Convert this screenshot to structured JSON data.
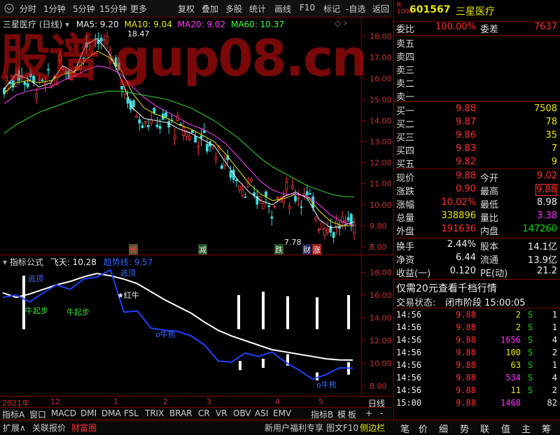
{
  "toolbar": {
    "items": [
      "分时",
      "1分钟",
      "5分钟",
      "15分钟",
      "更多",
      "复权",
      "叠加",
      "多股",
      "统计",
      "画线",
      "F10",
      "标记",
      "-自选",
      "返回"
    ]
  },
  "watermark": "股谱 gup08.cn",
  "main_chart": {
    "title": "三星医疗 (日线)",
    "ma5": "MA5: 9.20",
    "ma10": "MA10: 9.04",
    "ma20": "MA20: 9.02",
    "ma60": "MA60: 10.37",
    "high_label": "18.47",
    "low_label": "7.78",
    "yticks": [
      "18.00",
      "17.00",
      "16.00",
      "15.00",
      "14.00",
      "13.00",
      "12.00",
      "11.00",
      "10.00",
      "9.00",
      "8.00"
    ],
    "markers": [
      "榜",
      "减",
      "跌",
      "财",
      "涨"
    ]
  },
  "indicator": {
    "title": "指标公式",
    "feitian": "飞天: 10.28",
    "qushi": "趋势线: 9.57",
    "yticks": [
      "18.00",
      "16.00",
      "14.00",
      "12.00",
      "10.00",
      "8.00"
    ],
    "labels": [
      "逃顶",
      "牛起步",
      "牛起步",
      "逃顶",
      "★红牛",
      "o牛熊",
      "o牛熊"
    ]
  },
  "time_axis": {
    "labels": [
      "2021年",
      "12",
      "1",
      "2",
      "3",
      "4",
      "5"
    ],
    "period": "日线"
  },
  "indicator_tabs": [
    "指标A",
    "窗口",
    "MACD",
    "DMI",
    "DMA",
    "FSL",
    "TRIX",
    "BRAR",
    "CR",
    "VR",
    "OBV",
    "ASI",
    "EMV",
    "指标B",
    "模",
    "板",
    "+",
    "-"
  ],
  "status_bar": {
    "left": [
      "扩展∧",
      "关联报价",
      "财富圈"
    ],
    "promo": "新用户福利专享",
    "tabs": [
      "图文F10",
      "侧边栏"
    ]
  },
  "quote": {
    "code": "601567",
    "name": "三星医疗",
    "weibi_label": "委比",
    "weibi": "100.00%",
    "weicha_label": "委差",
    "weicha": "7637",
    "sell": [
      {
        "label": "卖五",
        "price": "",
        "vol": ""
      },
      {
        "label": "卖四",
        "price": "",
        "vol": ""
      },
      {
        "label": "卖三",
        "price": "",
        "vol": ""
      },
      {
        "label": "卖二",
        "price": "",
        "vol": ""
      },
      {
        "label": "卖一",
        "price": "",
        "vol": ""
      }
    ],
    "buy": [
      {
        "label": "买一",
        "price": "9.88",
        "vol": "7508"
      },
      {
        "label": "买二",
        "price": "9.87",
        "vol": "78"
      },
      {
        "label": "买三",
        "price": "9.86",
        "vol": "35"
      },
      {
        "label": "买四",
        "price": "9.83",
        "vol": "7"
      },
      {
        "label": "买五",
        "price": "9.82",
        "vol": "9"
      }
    ],
    "stats": [
      {
        "l1": "现价",
        "v1": "9.88",
        "c1": "red",
        "l2": "今开",
        "v2": "9.02",
        "c2": "red"
      },
      {
        "l1": "涨跌",
        "v1": "0.90",
        "c1": "red",
        "l2": "最高",
        "v2": "9.88",
        "c2": "red"
      },
      {
        "l1": "涨幅",
        "v1": "10.02%",
        "c1": "red",
        "l2": "最低",
        "v2": "8.98",
        "c2": "wht"
      },
      {
        "l1": "总量",
        "v1": "338896",
        "c1": "yel",
        "l2": "量比",
        "v2": "3.38",
        "c2": "mag"
      },
      {
        "l1": "外盘",
        "v1": "191636",
        "c1": "red",
        "l2": "内盘",
        "v2": "147260",
        "c2": "grn"
      }
    ],
    "stats2": [
      {
        "l1": "换手",
        "v1": "2.44%",
        "l2": "股本",
        "v2": "14.1亿"
      },
      {
        "l1": "净资",
        "v1": "6.44",
        "l2": "流通",
        "v2": "13.9亿"
      },
      {
        "l1": "收益(一)",
        "v1": "0.120",
        "l2": "PE(动)",
        "v2": "21.2"
      }
    ],
    "promo": "仅需20元查看千档行情",
    "trade_status_label": "交易状态:",
    "trade_status": "闭市阶段 15:00:05",
    "ticks": [
      {
        "t": "14:56",
        "p": "9.88",
        "v": "2",
        "vc": "yel",
        "s": "S",
        "n": "1"
      },
      {
        "t": "14:56",
        "p": "9.88",
        "v": "2",
        "vc": "yel",
        "s": "S",
        "n": "1"
      },
      {
        "t": "14:56",
        "p": "9.88",
        "v": "1656",
        "vc": "mag",
        "s": "S",
        "n": "4"
      },
      {
        "t": "14:56",
        "p": "9.88",
        "v": "100",
        "vc": "yel",
        "s": "S",
        "n": "2"
      },
      {
        "t": "14:56",
        "p": "9.88",
        "v": "63",
        "vc": "yel",
        "s": "S",
        "n": "1"
      },
      {
        "t": "14:56",
        "p": "9.88",
        "v": "534",
        "vc": "mag",
        "s": "S",
        "n": "4"
      },
      {
        "t": "14:56",
        "p": "9.88",
        "v": "11",
        "vc": "yel",
        "s": "S",
        "n": "2"
      },
      {
        "t": "15:00",
        "p": "9.88",
        "v": "1468",
        "vc": "mag",
        "s": "",
        "n": "82"
      }
    ],
    "bottom_tabs": [
      "笔",
      "价",
      "细",
      "势",
      "联",
      "值",
      "主",
      "筹"
    ]
  },
  "chart_data": [
    {
      "type": "line",
      "title": "三星医疗 (日线)",
      "ylim": [
        7.6,
        18.9
      ],
      "series": [
        {
          "name": "MA5: 9.20",
          "values": [
            15.5,
            16.2,
            16.0,
            15.6,
            15.8,
            16.6,
            16.3,
            17.6,
            17.9,
            17.2,
            16.0,
            14.6,
            14.1,
            14.0,
            13.9,
            13.6,
            13.4,
            13.1,
            12.8,
            12.0,
            11.2,
            10.6,
            10.2,
            10.0,
            10.4,
            10.6,
            10.3,
            9.3,
            8.9,
            9.0,
            9.2
          ]
        },
        {
          "name": "MA10: 9.04",
          "values": [
            15.3,
            15.8,
            15.9,
            15.8,
            15.9,
            16.2,
            16.3,
            16.9,
            17.3,
            17.0,
            16.4,
            15.3,
            14.6,
            14.3,
            14.1,
            13.8,
            13.6,
            13.3,
            13.0,
            12.4,
            11.7,
            11.0,
            10.5,
            10.2,
            10.3,
            10.5,
            10.4,
            9.7,
            9.2,
            9.0,
            9.0
          ]
        },
        {
          "name": "MA20: 9.02",
          "values": [
            14.8,
            15.2,
            15.4,
            15.5,
            15.6,
            15.9,
            16.1,
            16.4,
            16.6,
            16.5,
            16.2,
            15.6,
            15.1,
            14.7,
            14.4,
            14.1,
            13.8,
            13.6,
            13.3,
            12.9,
            12.3,
            11.7,
            11.1,
            10.7,
            10.5,
            10.5,
            10.4,
            10.0,
            9.5,
            9.2,
            9.0
          ]
        },
        {
          "name": "MA60: 10.37",
          "values": [
            13.4,
            13.8,
            14.1,
            14.4,
            14.6,
            14.8,
            15.0,
            15.2,
            15.3,
            15.4,
            15.4,
            15.3,
            15.2,
            15.1,
            15.0,
            14.8,
            14.6,
            14.3,
            14.0,
            13.6,
            13.2,
            12.7,
            12.2,
            11.8,
            11.5,
            11.2,
            10.9,
            10.7,
            10.5,
            10.4,
            10.37
          ]
        }
      ]
    },
    {
      "type": "line",
      "title": "指标公式",
      "ylim": [
        7.2,
        19.5
      ],
      "series": [
        {
          "name": "飞天: 10.28",
          "values": [
            16.2,
            15.8,
            16.1,
            16.5,
            16.9,
            17.2,
            17.6,
            17.9,
            17.7,
            17.4,
            17.0,
            16.3,
            15.6,
            15.0,
            14.4,
            13.6,
            12.9,
            12.4,
            12.0,
            11.6,
            11.2,
            11.0,
            10.8,
            10.6,
            10.4,
            10.3,
            10.28
          ]
        },
        {
          "name": "趋势线: 9.57",
          "values": [
            15.8,
            16.0,
            15.4,
            16.2,
            16.9,
            16.5,
            17.4,
            17.6,
            18.2,
            14.5,
            14.6,
            13.1,
            12.9,
            12.8,
            12.4,
            11.6,
            10.2,
            10.1,
            10.9,
            10.6,
            11.0,
            10.1,
            9.4,
            8.6,
            9.0,
            9.6,
            9.57
          ]
        }
      ]
    }
  ]
}
